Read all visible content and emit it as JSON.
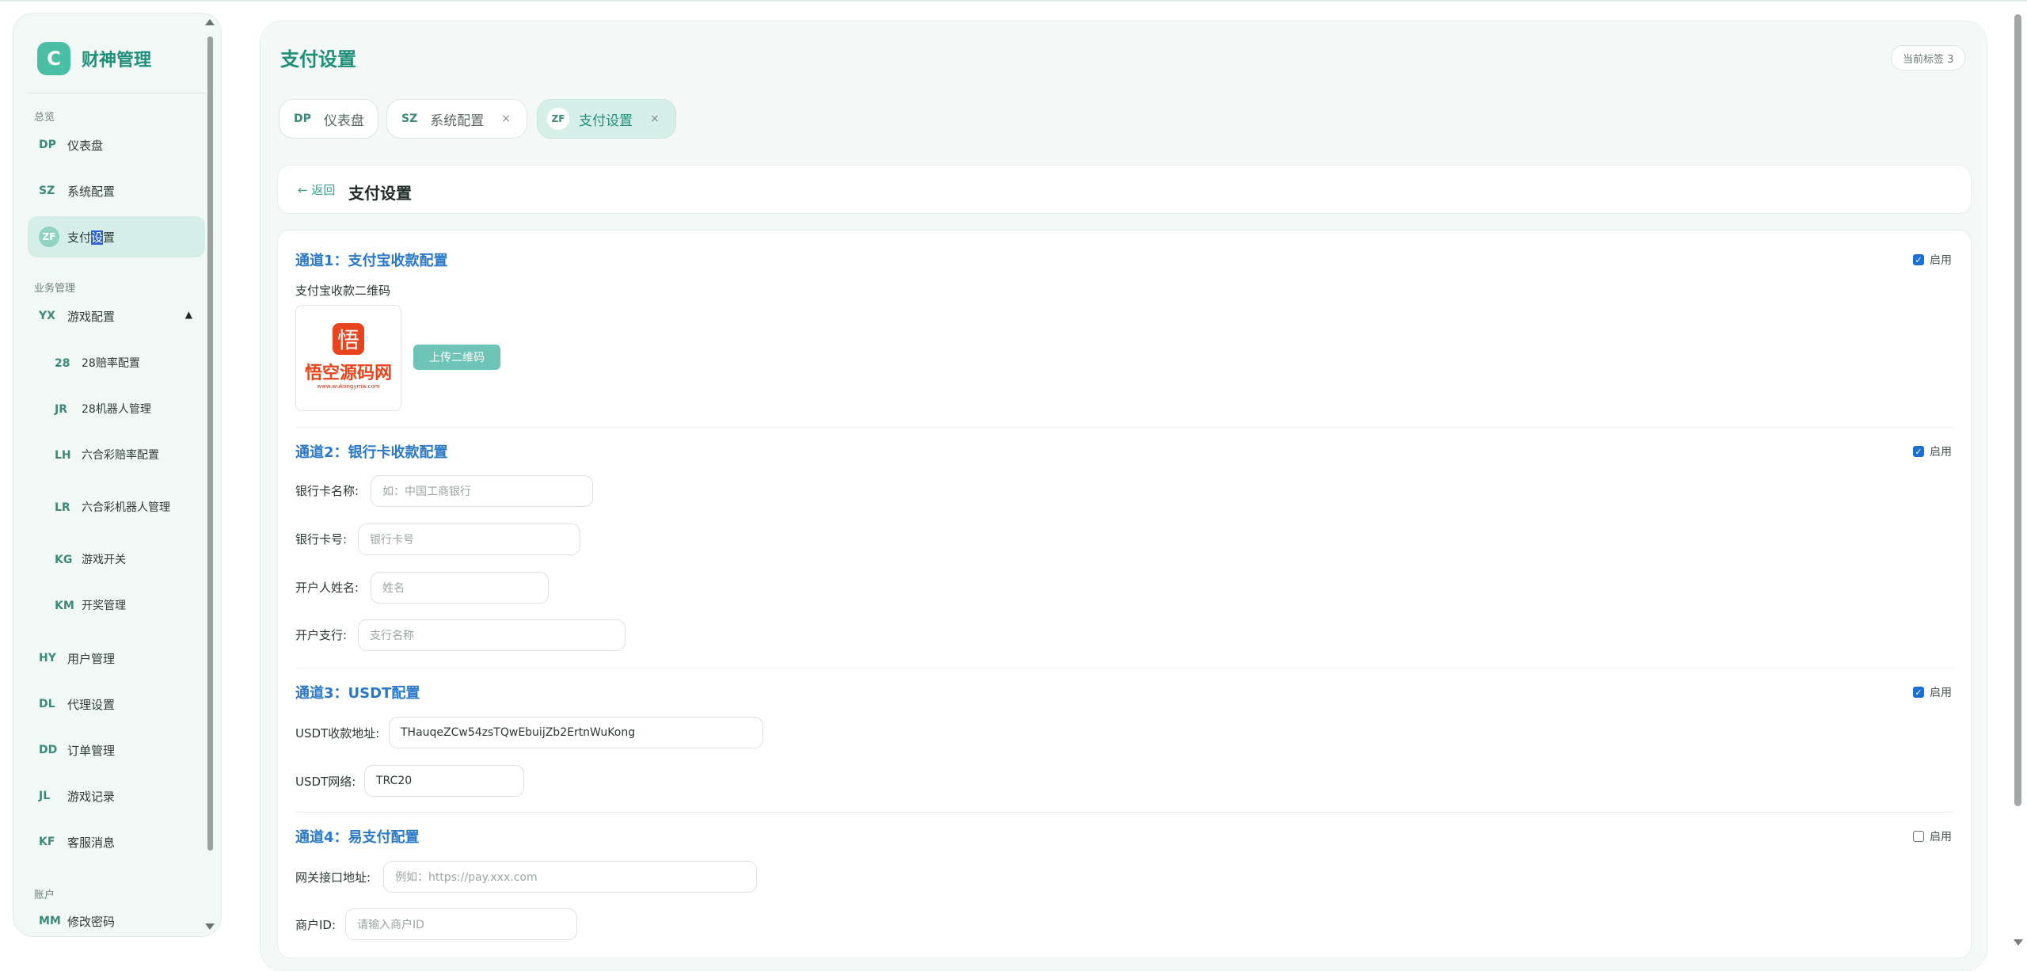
{
  "brand": {
    "logo_letter": "C",
    "name": "财神管理"
  },
  "sidebar": {
    "section_overview": "总览",
    "section_business": "业务管理",
    "section_account": "账户",
    "items": [
      {
        "abbr": "DP",
        "label": "仪表盘"
      },
      {
        "abbr": "SZ",
        "label": "系统配置"
      },
      {
        "abbr": "ZF",
        "label_before": "支付",
        "label_selected": "设",
        "label_after": "置"
      },
      {
        "abbr": "YX",
        "label": "游戏配置",
        "caret": "▲"
      },
      {
        "abbr": "HY",
        "label": "用户管理"
      },
      {
        "abbr": "DL",
        "label": "代理设置"
      },
      {
        "abbr": "DD",
        "label": "订单管理"
      },
      {
        "abbr": "JL",
        "label": "游戏记录"
      },
      {
        "abbr": "KF",
        "label": "客服消息"
      },
      {
        "abbr": "MM",
        "label": "修改密码"
      }
    ],
    "sub_items": [
      {
        "abbr": "28",
        "label": "28赔率配置"
      },
      {
        "abbr": "JR",
        "label": "28机器人管理"
      },
      {
        "abbr": "LH",
        "label": "六合彩赔率配置"
      },
      {
        "abbr": "LR",
        "label": "六合彩机器人管理"
      },
      {
        "abbr": "KG",
        "label": "游戏开关"
      },
      {
        "abbr": "KM",
        "label": "开奖管理"
      }
    ]
  },
  "header": {
    "title": "支付设置",
    "tag_count": "当前标签 3"
  },
  "tabs": [
    {
      "abbr": "DP",
      "label": "仪表盘"
    },
    {
      "abbr": "SZ",
      "label": "系统配置",
      "close": "×"
    },
    {
      "abbr": "ZF",
      "label": "支付设置",
      "close": "×"
    }
  ],
  "page": {
    "back_label": "← 返回",
    "title": "支付设置"
  },
  "enable_label": "启用",
  "channels": {
    "alipay": {
      "title": "通道1：支付宝收款配置",
      "enabled": true,
      "qr_label": "支付宝收款二维码",
      "upload_label": "上传二维码",
      "qr_logo_char": "悟",
      "qr_text": "悟空源码网",
      "qr_url": "www.wukongymw.com"
    },
    "bank": {
      "title": "通道2：银行卡收款配置",
      "enabled": true,
      "fields": [
        {
          "label": "银行卡名称:",
          "placeholder": "如：中国工商银行"
        },
        {
          "label": "银行卡号:",
          "placeholder": "银行卡号"
        },
        {
          "label": "开户人姓名:",
          "placeholder": "姓名"
        },
        {
          "label": "开户支行:",
          "placeholder": "支行名称"
        }
      ]
    },
    "usdt": {
      "title": "通道3：USDT配置",
      "enabled": true,
      "fields": [
        {
          "label": "USDT收款地址:",
          "value": "THauqeZCw54zsTQwEbuijZb2ErtnWuKong"
        },
        {
          "label": "USDT网络:",
          "value": "TRC20"
        }
      ]
    },
    "easypay": {
      "title": "通道4：易支付配置",
      "enabled": false,
      "fields": [
        {
          "label": "网关接口地址:",
          "placeholder": "例如：https://pay.xxx.com"
        },
        {
          "label": "商户ID:",
          "placeholder": "请输入商户ID"
        }
      ]
    }
  },
  "colors": {
    "accent": "#1f8f7a",
    "channel_title": "#2a78c8",
    "checkbox": "#1a6fd1",
    "qr_red": "#e8451f"
  }
}
